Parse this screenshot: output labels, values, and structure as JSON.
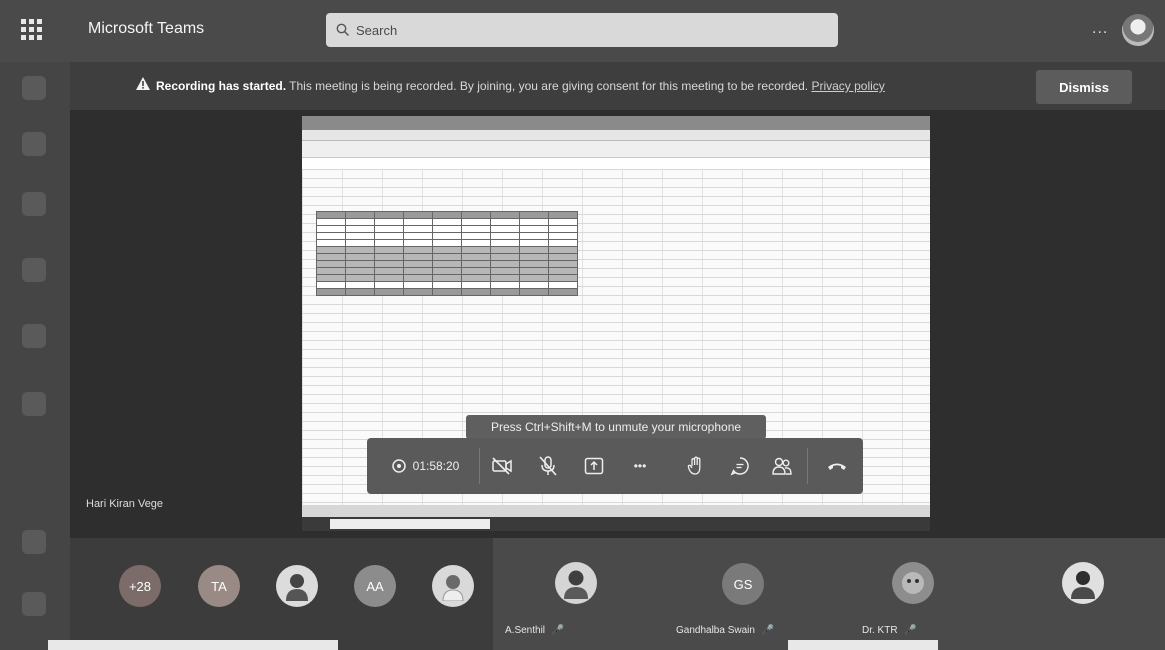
{
  "app": {
    "title": "Microsoft Teams"
  },
  "search": {
    "placeholder": "Search"
  },
  "topbar": {
    "more_label": "..."
  },
  "banner": {
    "bold_text": "Recording has started.",
    "text": " This meeting is being recorded. By joining, you are giving consent for this meeting to be recorded. ",
    "link_text": "Privacy policy",
    "dismiss_label": "Dismiss"
  },
  "presenter": {
    "name": "Hari Kiran Vege"
  },
  "tooltip": {
    "text": "Press Ctrl+Shift+M to unmute your microphone"
  },
  "controls": {
    "timer": "01:58:20",
    "more_label": "•••",
    "icons": [
      "camera-off-icon",
      "mic-muted-icon",
      "share-tray-icon",
      "more-icon",
      "raise-hand-icon",
      "chat-icon",
      "participants-icon",
      "hang-up-icon"
    ]
  },
  "participants": {
    "overflow_label": "+28",
    "people": [
      {
        "initials": "TA",
        "color": "#9a8a86"
      },
      {
        "initials": "",
        "color": "#dcdcdc"
      },
      {
        "initials": "AA",
        "color": "#8c8c8c"
      },
      {
        "initials": "",
        "color": "#d9d9d9"
      }
    ],
    "tiles": [
      {
        "name": "A.Senthil"
      },
      {
        "name": "Gandhalba Swain",
        "initials": "GS"
      },
      {
        "name": "Dr. KTR"
      },
      {
        "name": ""
      }
    ]
  },
  "colors": {
    "overflow_badge": "#7b6c69",
    "banner_bg": "#3e3e3e"
  }
}
